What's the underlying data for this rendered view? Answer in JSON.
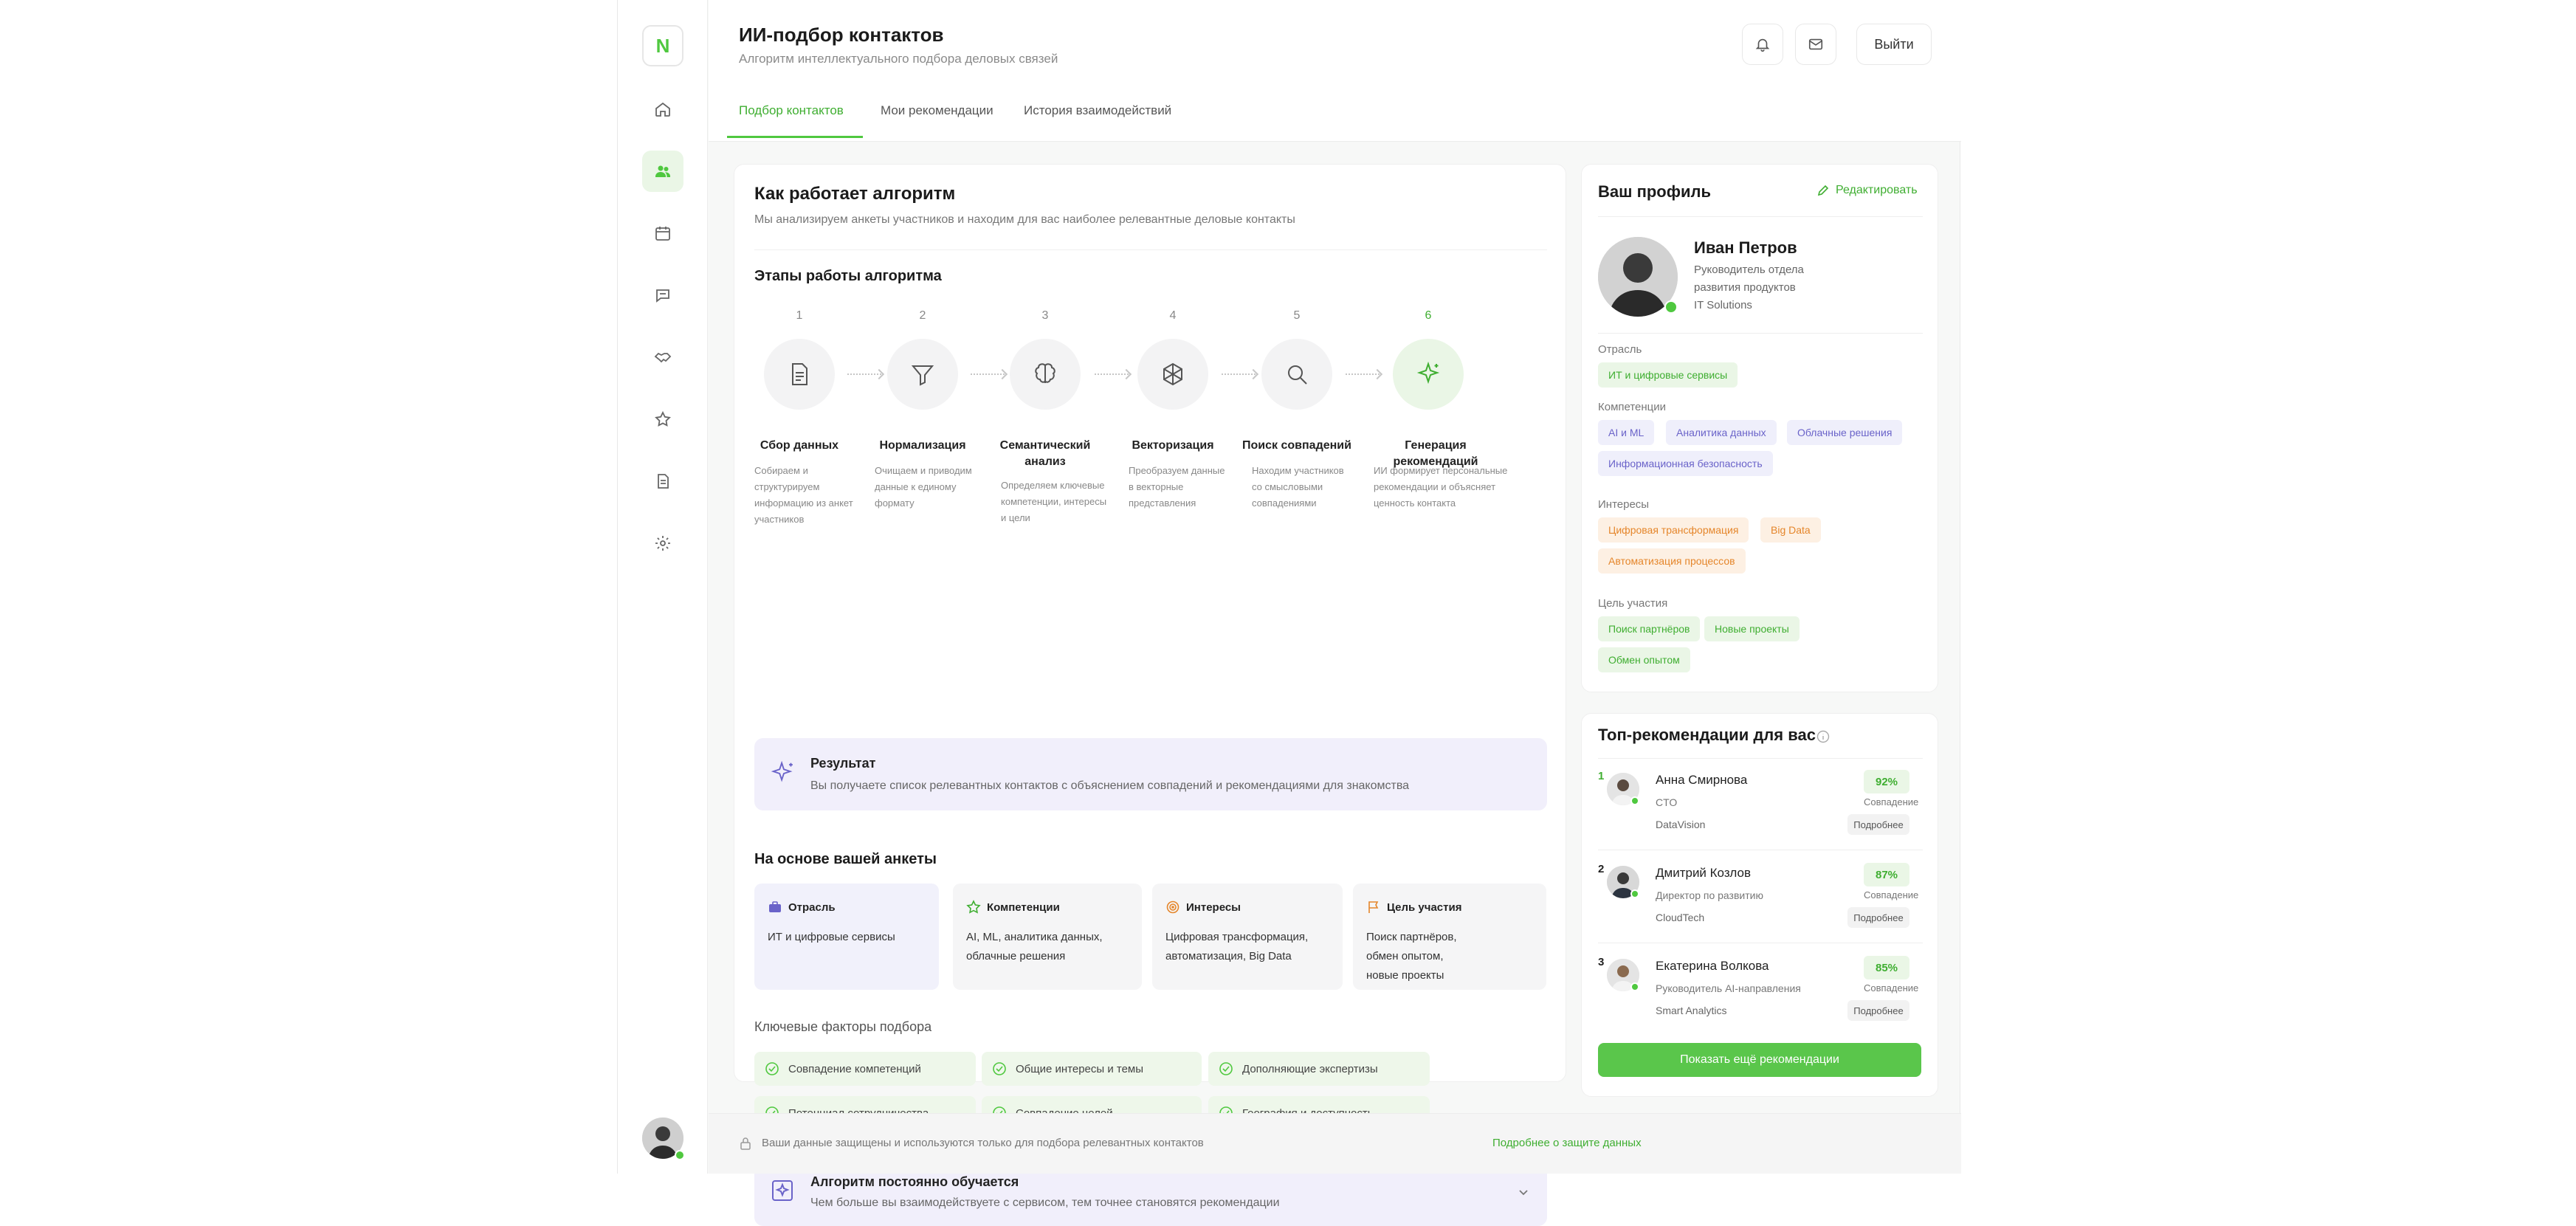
{
  "app": {
    "logo_letter": "N",
    "accent_color": "#4fc83f",
    "nav_icons": [
      "home-icon",
      "users-icon",
      "calendar-icon",
      "chat-icon",
      "handshake-icon",
      "star-icon",
      "document-icon",
      "gear-icon"
    ]
  },
  "header": {
    "title": "ИИ-подбор контактов",
    "subtitle": "Алгоритм интеллектуального подбора деловых связей",
    "logout_label": "Выйти",
    "tabs": [
      {
        "label": "Подбор контактов",
        "active": true
      },
      {
        "label": "Мои рекомендации",
        "active": false
      },
      {
        "label": "История взаимодействий",
        "active": false
      }
    ]
  },
  "algorithm": {
    "title": "Как работает алгоритм",
    "description": "Мы анализируем анкеты участников и находим для вас наиболее релевантные деловые контакты",
    "stages_title": "Этапы работы алгоритма",
    "steps": [
      {
        "num": "1",
        "name": "Сбор данных",
        "desc": "Собираем и структурируем информацию из анкет участников"
      },
      {
        "num": "2",
        "name": "Нормализация",
        "desc": "Очищаем и приводим данные к единому формату"
      },
      {
        "num": "3",
        "name": "Семантический анализ",
        "desc": "Определяем ключевые компетенции, интересы и цели"
      },
      {
        "num": "4",
        "name": "Векторизация",
        "desc": "Преобразуем данные в векторные представления"
      },
      {
        "num": "5",
        "name": "Поиск совпадений",
        "desc": "Находим участников со смысловыми совпадениями"
      },
      {
        "num": "6",
        "name": "Генерация рекомендаций",
        "desc": "ИИ формирует персональные рекомендации и объясняет ценность контакта"
      }
    ],
    "result_title": "Результат",
    "result_text": "Вы получаете список релевантных контактов с объяснением совпадений и рекомендациями для знакомства",
    "basis_title": "На основе вашей анкеты",
    "basis": [
      {
        "label": "Отрасль",
        "value": "ИТ и цифровые сервисы"
      },
      {
        "label": "Компетенции",
        "value": "AI, ML, аналитика данных, облачные решения"
      },
      {
        "label": "Интересы",
        "value": "Цифровая трансформация, автоматизация, Big Data"
      },
      {
        "label": "Цель участия",
        "value": "Поиск партнёров, обмен опытом, новые проекты"
      }
    ],
    "factors_title": "Ключевые факторы подбора",
    "factors": [
      "Совпадение компетенций",
      "Общие интересы и темы",
      "Дополняющие экспертизы",
      "Потенциал сотрудничества",
      "Совпадение целей",
      "География и доступность"
    ],
    "learning_title": "Алгоритм постоянно обучается",
    "learning_text": "Чем больше вы взаимодействуете с сервисом, тем точнее становятся рекомендации"
  },
  "profile": {
    "title": "Ваш профиль",
    "edit_label": "Редактировать",
    "name": "Иван Петров",
    "role_line1": "Руководитель отдела",
    "role_line2": "развития продуктов",
    "company": "IT Solutions",
    "industry_label": "Отрасль",
    "industry": [
      "ИТ и цифровые сервисы"
    ],
    "competencies_label": "Компетенции",
    "competencies": [
      "AI и ML",
      "Аналитика данных",
      "Облачные решения",
      "Информационная безопасность"
    ],
    "interests_label": "Интересы",
    "interests": [
      "Цифровая трансформация",
      "Big Data",
      "Автоматизация процессов"
    ],
    "goals_label": "Цель участия",
    "goals": [
      "Поиск партнёров",
      "Новые проекты",
      "Обмен опытом"
    ]
  },
  "recommendations": {
    "title": "Топ-рекомендации для вас",
    "match_label": "Совпадение",
    "more_label": "Подробнее",
    "show_more_label": "Показать ещё рекомендации",
    "items": [
      {
        "rank": "1",
        "name": "Анна Смирнова",
        "role": "CTO",
        "company": "DataVision",
        "match": "92%"
      },
      {
        "rank": "2",
        "name": "Дмитрий Козлов",
        "role": "Директор по развитию",
        "company": "CloudTech",
        "match": "87%"
      },
      {
        "rank": "3",
        "name": "Екатерина Волкова",
        "role": "Руководитель AI-направления",
        "company": "Smart Analytics",
        "match": "85%"
      }
    ]
  },
  "footer": {
    "privacy_text": "Ваши данные защищены и используются только для подбора релевантных контактов",
    "privacy_link": "Подробнее о защите данных"
  }
}
